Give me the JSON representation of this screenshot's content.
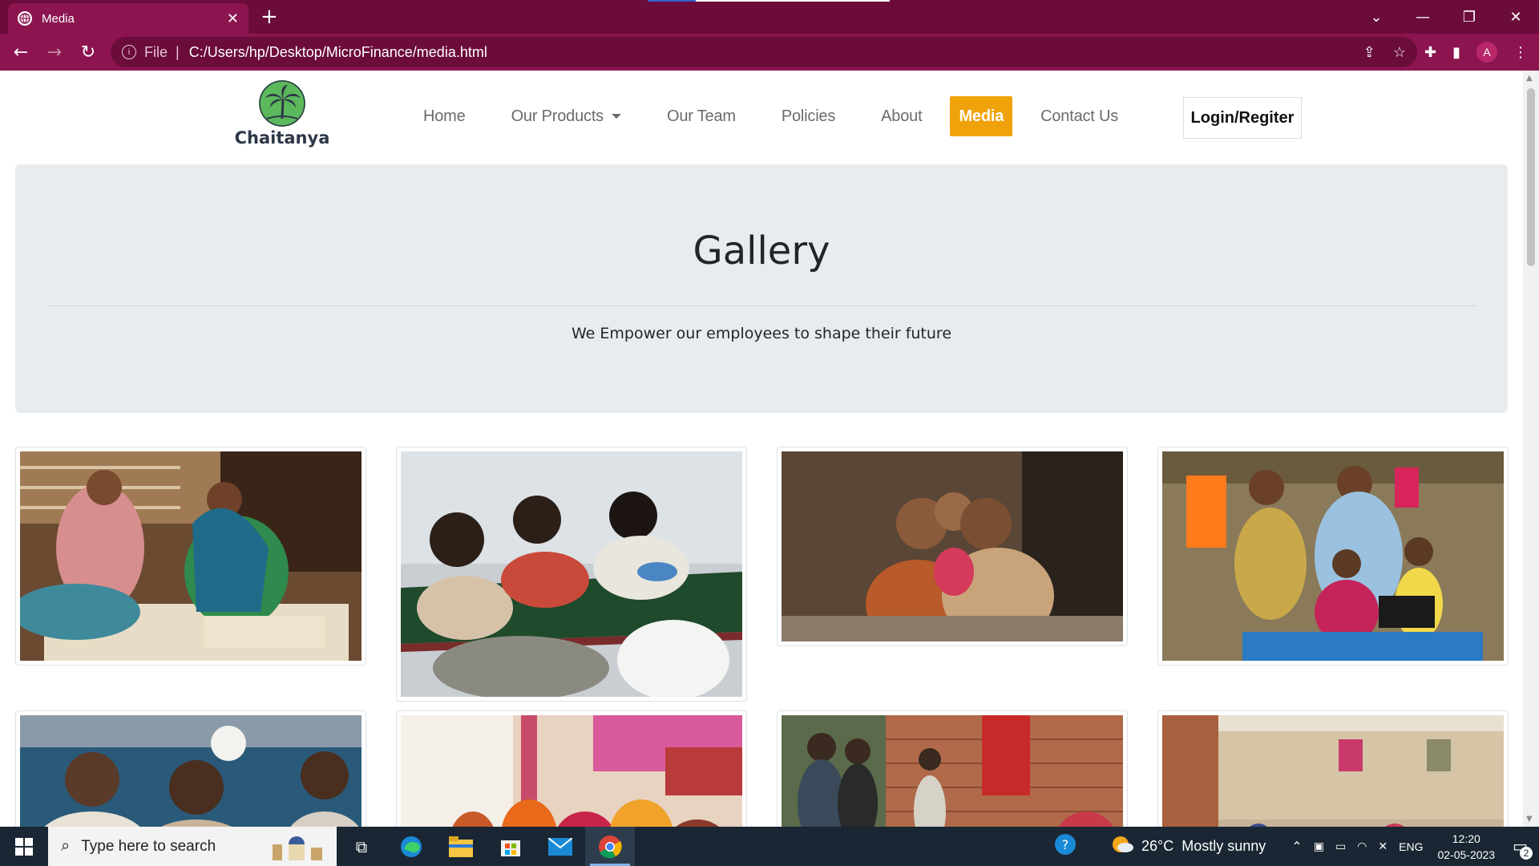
{
  "browser": {
    "tab_title": "Media",
    "url_scheme": "File",
    "url": "C:/Users/hp/Desktop/MicroFinance/media.html",
    "avatar_letter": "A"
  },
  "site": {
    "brand": "Chaitanya",
    "nav": [
      {
        "label": "Home"
      },
      {
        "label": "Our Products"
      },
      {
        "label": "Our Team"
      },
      {
        "label": "Policies"
      },
      {
        "label": "About"
      },
      {
        "label": "Media"
      },
      {
        "label": "Contact Us"
      }
    ],
    "active_nav": "Media",
    "login_label": "Login/Regiter",
    "accent_color": "#f0a20b"
  },
  "hero": {
    "title": "Gallery",
    "subtitle": "We Empower our employees to shape their future"
  },
  "gallery": {
    "images": [
      {
        "subject": "artisans weaving"
      },
      {
        "subject": "boys studying"
      },
      {
        "subject": "family portrait"
      },
      {
        "subject": "family with sewing machine"
      },
      {
        "subject": "men by the lake"
      },
      {
        "subject": "women seated in village"
      },
      {
        "subject": "villagers by brick wall"
      },
      {
        "subject": "village gathering"
      }
    ]
  },
  "taskbar": {
    "search_placeholder": "Type here to search",
    "temperature": "26°C",
    "weather": "Mostly sunny",
    "language": "ENG",
    "time": "12:20",
    "date": "02-05-2023",
    "notification_count": "2"
  }
}
